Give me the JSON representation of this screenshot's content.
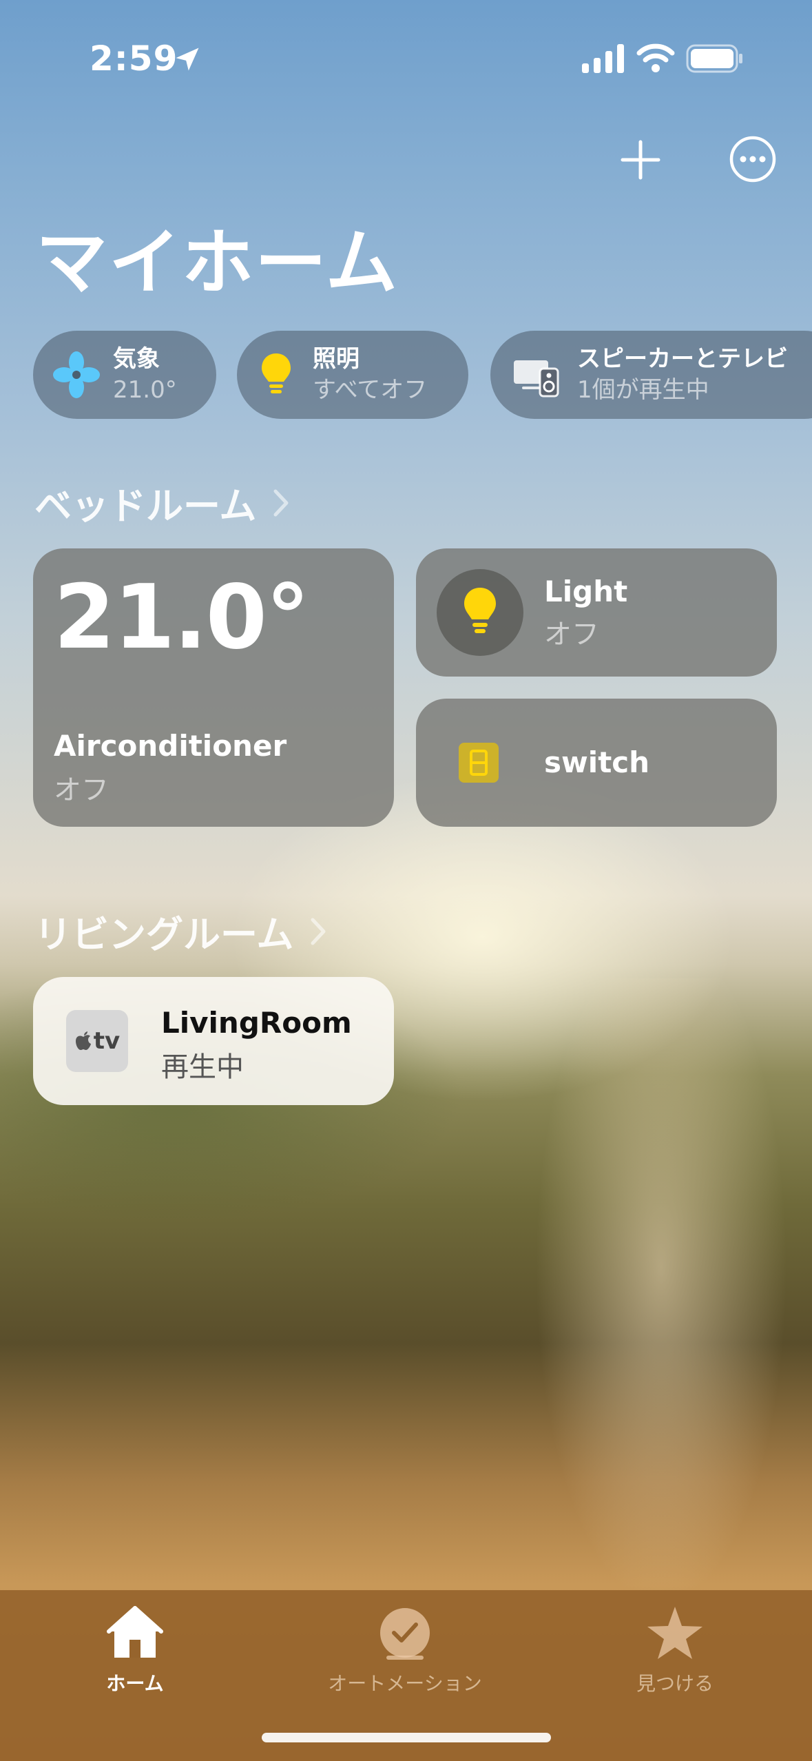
{
  "status_bar": {
    "time": "2:59",
    "icons": [
      "location-arrow-icon",
      "cellular-signal-icon",
      "wifi-icon",
      "battery-icon"
    ]
  },
  "header": {
    "title": "マイホーム",
    "actions": [
      "add-icon",
      "more-icon"
    ]
  },
  "chips": [
    {
      "title": "気象",
      "subtitle": "21.0°",
      "icon": "fan-icon",
      "icon_color": "#5ac8fa"
    },
    {
      "title": "照明",
      "subtitle": "すべてオフ",
      "icon": "lightbulb-icon",
      "icon_color": "#ffd60a"
    },
    {
      "title": "スピーカーとテレビ",
      "subtitle": "1個が再生中",
      "icon": "tv-speaker-icon"
    }
  ],
  "bedroom": {
    "title": "ベッドルーム",
    "aircon": {
      "temperature": "21.0°",
      "name": "Airconditioner",
      "status": "オフ"
    },
    "light": {
      "name": "Light",
      "status": "オフ"
    },
    "switch": {
      "name": "switch"
    }
  },
  "living": {
    "title": "リビングルーム",
    "appletv": {
      "icon_text": "tv",
      "name": "LivingRoom",
      "status": "再生中"
    }
  },
  "tabs": [
    {
      "label": "ホーム",
      "icon": "house-icon",
      "selected": true
    },
    {
      "label": "オートメーション",
      "icon": "clock-check-icon",
      "selected": false
    },
    {
      "label": "見つける",
      "icon": "star-icon",
      "selected": false
    }
  ],
  "colors": {
    "accent_yellow": "#ffd60a",
    "weather_blue": "#5ac8fa",
    "tab_bar": "#96642d"
  }
}
